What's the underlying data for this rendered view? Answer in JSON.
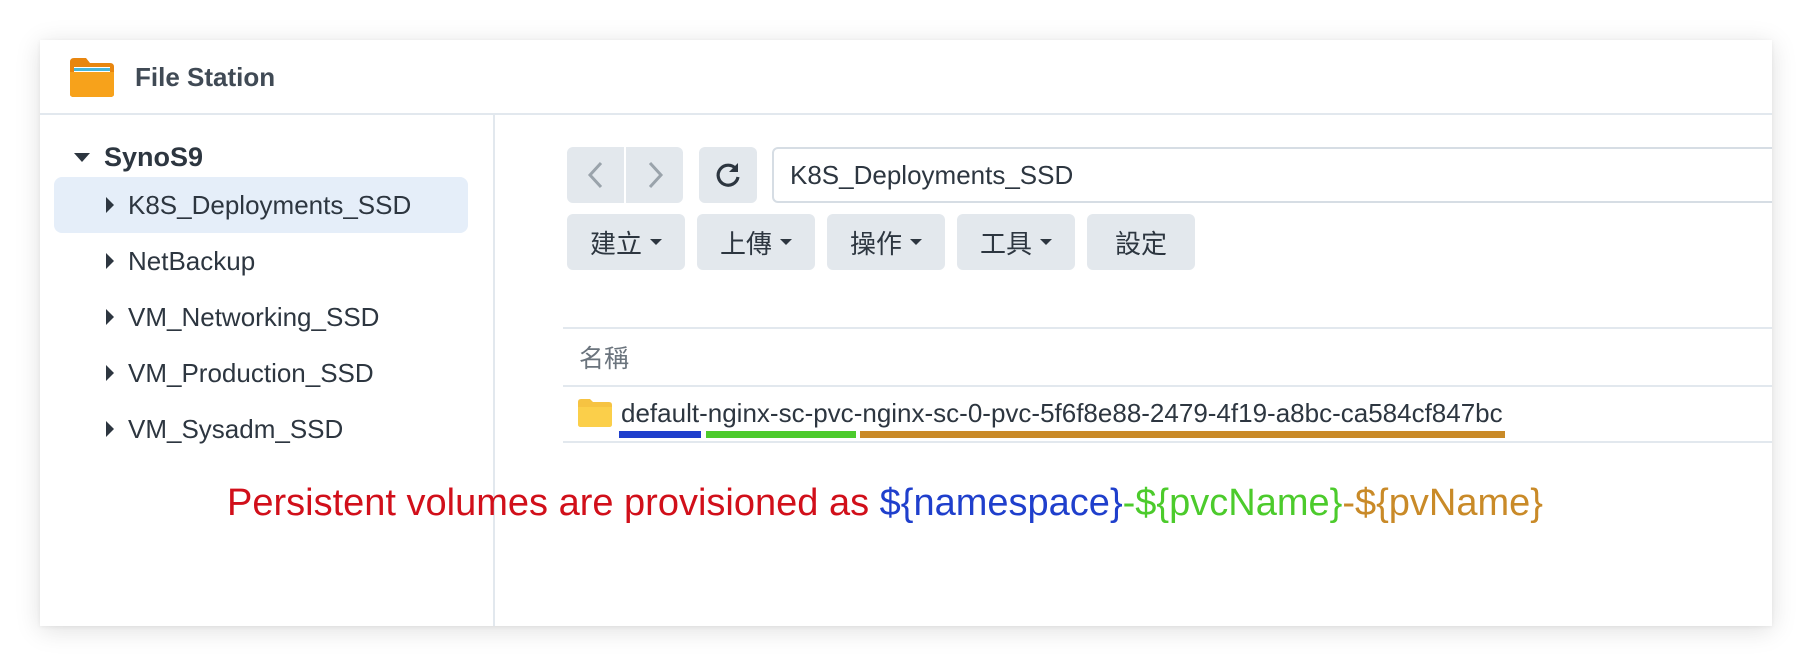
{
  "app": {
    "title": "File Station",
    "icon": "folder-app-icon"
  },
  "sidebar": {
    "root": "SynoS9",
    "items": [
      {
        "label": "K8S_Deployments_SSD",
        "selected": true
      },
      {
        "label": "NetBackup",
        "selected": false
      },
      {
        "label": "VM_Networking_SSD",
        "selected": false
      },
      {
        "label": "VM_Production_SSD",
        "selected": false
      },
      {
        "label": "VM_Sysadm_SSD",
        "selected": false
      }
    ]
  },
  "navigation": {
    "back_icon": "chevron-left-icon",
    "forward_icon": "chevron-right-icon",
    "refresh_icon": "refresh-icon",
    "path": "K8S_Deployments_SSD"
  },
  "toolbar": {
    "create": "建立",
    "upload": "上傳",
    "action": "操作",
    "tools": "工具",
    "settings": "設定"
  },
  "file_list": {
    "column_name": "名稱",
    "rows": [
      {
        "name_parts": {
          "namespace": "default",
          "sep1": "-",
          "pvc_name": "nginx-sc-pvc",
          "sep2": "-",
          "pv_name": "nginx-sc-0-pvc-5f6f8e88-2479-4f19-a8bc-ca584cf847bc"
        }
      }
    ]
  },
  "annotation": {
    "prefix": "Persistent volumes are provisioned as ",
    "namespace": "${namespace}",
    "sep1": "-",
    "pvc": "${pvcName}",
    "sep2": "-",
    "pv": "${pvName}"
  },
  "colors": {
    "annotation_text": "#d10f1a",
    "namespace": "#1f3fcc",
    "pvc": "#4ccb2c",
    "pv": "#c98a28",
    "selected_bg": "#e5eef9"
  }
}
